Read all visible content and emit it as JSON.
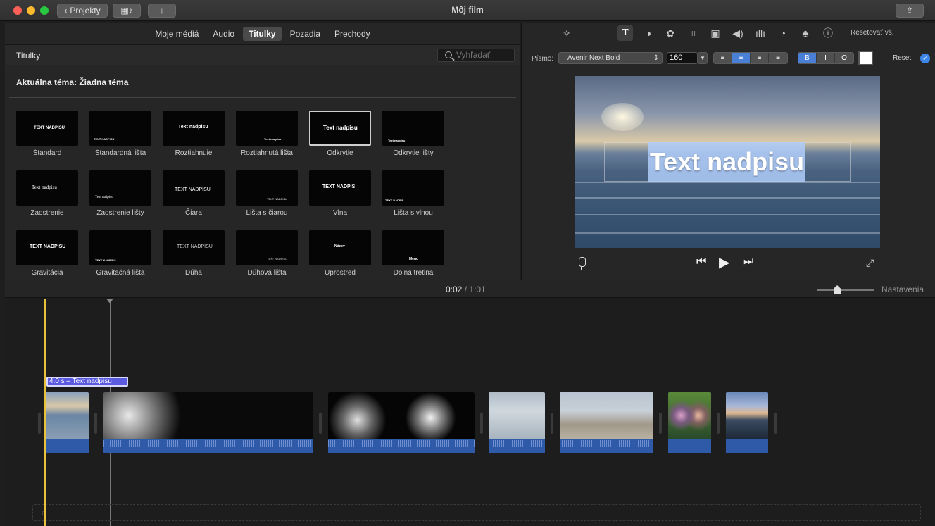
{
  "titlebar": {
    "title": "Môj film",
    "projects_button": "Projekty"
  },
  "browser": {
    "tabs": [
      {
        "label": "Moje médiá",
        "active": false
      },
      {
        "label": "Audio",
        "active": false
      },
      {
        "label": "Titulky",
        "active": true
      },
      {
        "label": "Pozadia",
        "active": false
      },
      {
        "label": "Prechody",
        "active": false
      }
    ],
    "header_title": "Titulky",
    "search_placeholder": "Vyhľadať",
    "theme_label": "Aktuálna téma: Žiadna téma",
    "titles": [
      {
        "caption": "Štandard",
        "thumb_text": "TEXT NADPISU"
      },
      {
        "caption": "Štandardná lišta",
        "thumb_text": "TEXT NADPISU"
      },
      {
        "caption": "Roztiahnuie",
        "thumb_text": "Text nadpisu"
      },
      {
        "caption": "Roztiahnutá lišta",
        "thumb_text": "Text nadpisu"
      },
      {
        "caption": "Odkrytie",
        "thumb_text": "Text nadpisu",
        "selected": true
      },
      {
        "caption": "Odkrytie lišty",
        "thumb_text": "Text nadpisu"
      },
      {
        "caption": "Zaostrenie",
        "thumb_text": "Text nadpisu"
      },
      {
        "caption": "Zaostrenie lišty",
        "thumb_text": "Text nadpisu"
      },
      {
        "caption": "Čiara",
        "thumb_text": "TEXT NADPISU"
      },
      {
        "caption": "Lišta s čiarou",
        "thumb_text": "TEXT NADPISU"
      },
      {
        "caption": "Vlna",
        "thumb_text": "TEXT NADPIS"
      },
      {
        "caption": "Lišta s vlnou",
        "thumb_text": "TEXT NADPIS"
      },
      {
        "caption": "Gravitácia",
        "thumb_text": "TEXT NADPISU"
      },
      {
        "caption": "Gravitačná lišta",
        "thumb_text": "TEXT NADPISU"
      },
      {
        "caption": "Dúha",
        "thumb_text": "TEXT NADPISU"
      },
      {
        "caption": "Dúhová lišta",
        "thumb_text": "TEXT NADPISU"
      },
      {
        "caption": "Uprostred",
        "thumb_text": "Názov"
      },
      {
        "caption": "Dolná tretina",
        "thumb_text": "Meno"
      }
    ]
  },
  "viewer": {
    "reset_all": "Resetovať vš.",
    "font_label": "Písmo:",
    "font_value": "Avenir Next Bold",
    "font_size": "160",
    "style_buttons": [
      "B",
      "I",
      "O"
    ],
    "reset_label": "Reset",
    "preview_title": "Text nadpisu"
  },
  "timeline": {
    "current_time": "0:02",
    "separator": "/",
    "total_time": "1:01",
    "settings_label": "Nastavenia",
    "title_clip_label": "4.0 s – Text nadpisu"
  },
  "colors": {
    "accent": "#4a7fd6",
    "audio": "#2f5aa8",
    "playhead": "#e8c23a",
    "title_clip": "#5b5be0"
  }
}
